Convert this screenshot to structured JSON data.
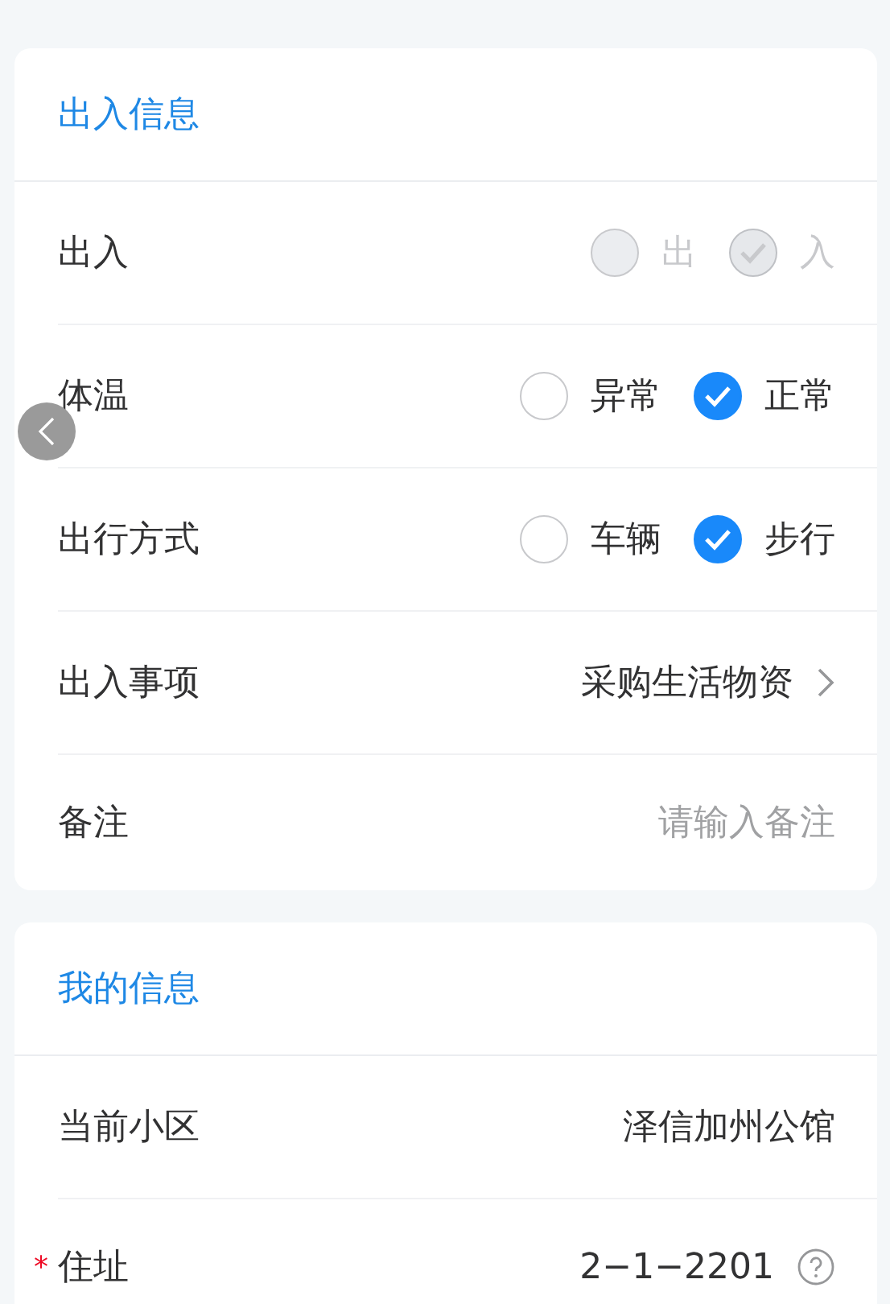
{
  "sections": [
    {
      "title": "出入信息",
      "rows": [
        {
          "kind": "radio",
          "label": "出入",
          "disabled": true,
          "options": [
            {
              "label": "出",
              "selected": false
            },
            {
              "label": "入",
              "selected": true
            }
          ]
        },
        {
          "kind": "radio",
          "label": "体温",
          "disabled": false,
          "options": [
            {
              "label": "异常",
              "selected": false
            },
            {
              "label": "正常",
              "selected": true
            }
          ]
        },
        {
          "kind": "radio",
          "label": "出行方式",
          "disabled": false,
          "options": [
            {
              "label": "车辆",
              "selected": false
            },
            {
              "label": "步行",
              "selected": true
            }
          ]
        },
        {
          "kind": "select",
          "label": "出入事项",
          "value": "采购生活物资"
        },
        {
          "kind": "input",
          "label": "备注",
          "placeholder": "请输入备注"
        }
      ]
    },
    {
      "title": "我的信息",
      "rows": [
        {
          "kind": "text",
          "label": "当前小区",
          "value": "泽信加州公馆"
        },
        {
          "kind": "help",
          "label": "住址",
          "required_mark": "*",
          "value": "2−1−2201"
        }
      ]
    }
  ]
}
